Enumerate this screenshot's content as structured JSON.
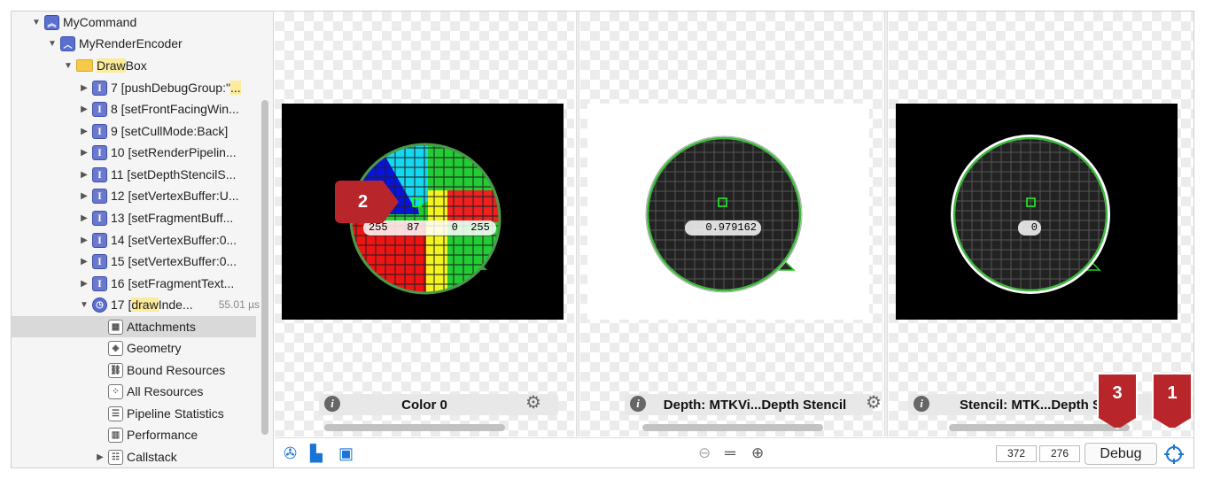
{
  "sidebar": {
    "items": [
      {
        "label": "MyCommand"
      },
      {
        "label": "MyRenderEncoder"
      },
      {
        "label_hl": "Draw",
        "label_rest": "Box"
      },
      {
        "label": "7 [pushDebugGroup:\""
      },
      {
        "label": "8 [setFrontFacingWin..."
      },
      {
        "label": "9 [setCullMode:Back]"
      },
      {
        "label": "10 [setRenderPipelin..."
      },
      {
        "label": "11 [setDepthStencilS..."
      },
      {
        "label": "12 [setVertexBuffer:U..."
      },
      {
        "label": "13 [setFragmentBuff..."
      },
      {
        "label": "14 [setVertexBuffer:0..."
      },
      {
        "label": "15 [setVertexBuffer:0..."
      },
      {
        "label": "16 [setFragmentText..."
      },
      {
        "label_pre": "17 [",
        "label_hl": "draw",
        "label_rest": "Inde...",
        "duration": "55.01 µs"
      },
      {
        "label": "Attachments"
      },
      {
        "label": "Geometry"
      },
      {
        "label": "Bound Resources"
      },
      {
        "label": "All Resources"
      },
      {
        "label": "Pipeline Statistics"
      },
      {
        "label": "Performance"
      },
      {
        "label": "Callstack"
      }
    ],
    "item7_hl": "..."
  },
  "panes": [
    {
      "caption": "Color 0",
      "pixel_readout": "255   87     0  255"
    },
    {
      "caption": "Depth: MTKVi...Depth Stencil",
      "pixel_readout": "0.979162"
    },
    {
      "caption": "Stencil: MTK...Depth S",
      "pixel_readout": "0"
    }
  ],
  "bottombar": {
    "coord_x": "372",
    "coord_y": "276",
    "debug_label": "Debug"
  },
  "callouts": {
    "one": "1",
    "two": "2",
    "three": "3"
  },
  "colors": {
    "accent": "#1a73d9",
    "callout": "#b8262b"
  }
}
